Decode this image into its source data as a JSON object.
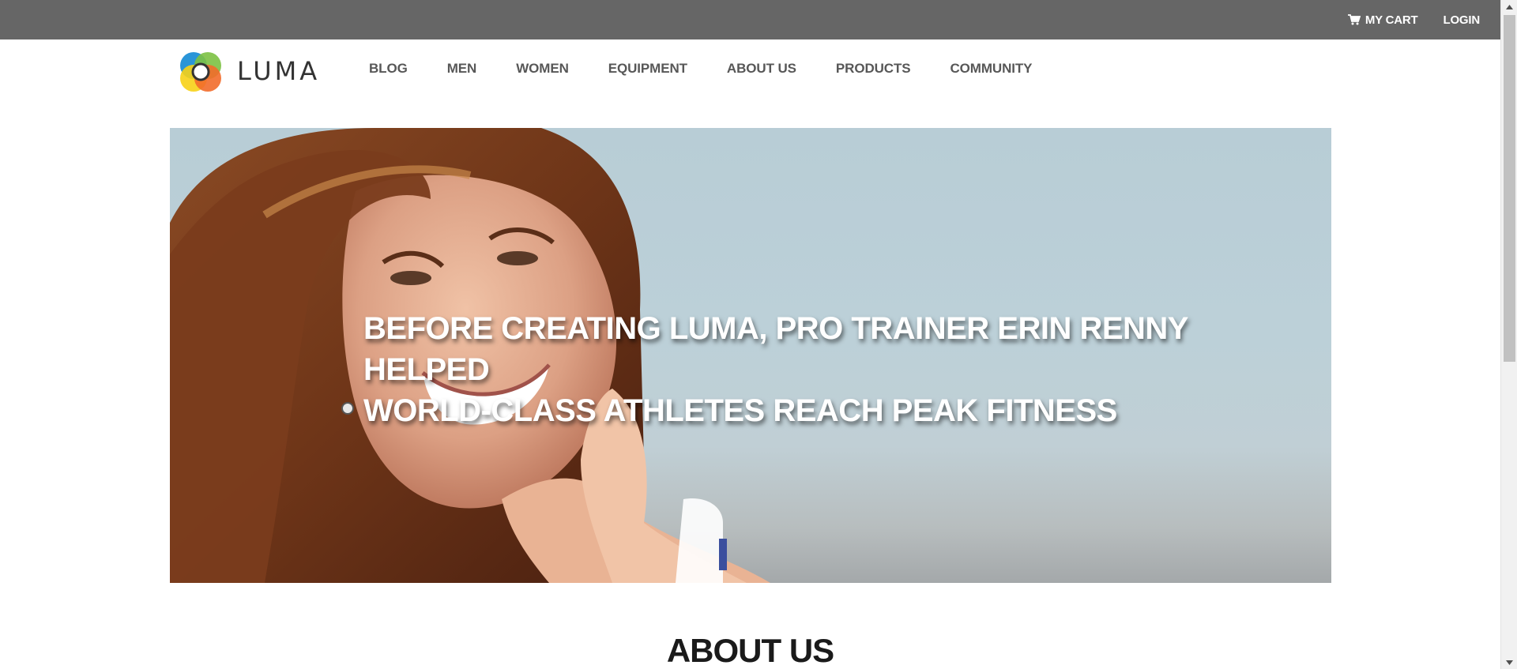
{
  "topbar": {
    "cart_label": "MY CART",
    "cart_icon": "cart-icon",
    "login_label": "LOGIN"
  },
  "header": {
    "logo_text": "LUMA",
    "logo_icon": "luma-logo-icon",
    "nav": [
      {
        "label": "BLOG"
      },
      {
        "label": "MEN"
      },
      {
        "label": "WOMEN"
      },
      {
        "label": "EQUIPMENT"
      },
      {
        "label": "ABOUT US"
      },
      {
        "label": "PRODUCTS"
      },
      {
        "label": "COMMUNITY"
      }
    ]
  },
  "hero": {
    "line1": "BEFORE CREATING LUMA, PRO TRAINER ERIN RENNY HELPED",
    "line2": "WORLD-CLASS ATHLETES REACH PEAK FITNESS"
  },
  "about": {
    "heading": "ABOUT US"
  },
  "colors": {
    "topbar_bg": "#666666",
    "nav_text": "#575757",
    "hero_sky": "#b8cdd6"
  }
}
